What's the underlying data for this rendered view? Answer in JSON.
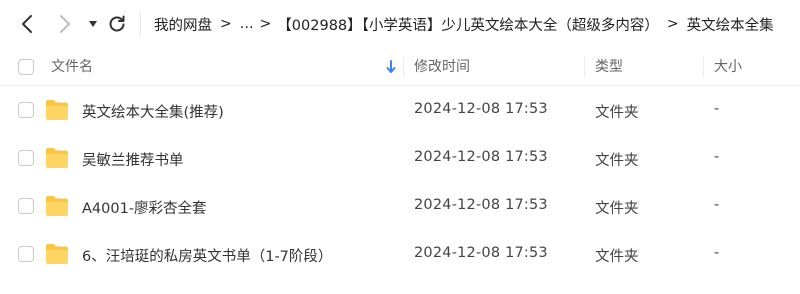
{
  "nav": {
    "back_icon": "chevron-left-icon",
    "forward_icon": "chevron-right-icon",
    "dropdown_icon": "caret-down-icon",
    "refresh_icon": "refresh-icon"
  },
  "breadcrumb": {
    "items": [
      "我的网盘",
      "...",
      "【002988】【小学英语】少儿英文绘本大全（超级多内容）",
      "英文绘本全集"
    ],
    "separator": ">"
  },
  "table": {
    "columns": {
      "name": "文件名",
      "modified": "修改时间",
      "type": "类型",
      "size": "大小"
    },
    "sort_icon": "sort-down-arrow-icon",
    "accent_color": "#3b82f6",
    "folder_color": "#ffc53d",
    "rows": [
      {
        "name": "英文绘本大全集(推荐)",
        "modified": "2024-12-08 17:53",
        "type": "文件夹",
        "size": "-"
      },
      {
        "name": "吴敏兰推荐书单",
        "modified": "2024-12-08 17:53",
        "type": "文件夹",
        "size": "-"
      },
      {
        "name": "A4001-廖彩杏全套",
        "modified": "2024-12-08 17:53",
        "type": "文件夹",
        "size": "-"
      },
      {
        "name": "6、汪培珽的私房英文书单（1-7阶段）",
        "modified": "2024-12-08 17:53",
        "type": "文件夹",
        "size": "-"
      }
    ]
  }
}
